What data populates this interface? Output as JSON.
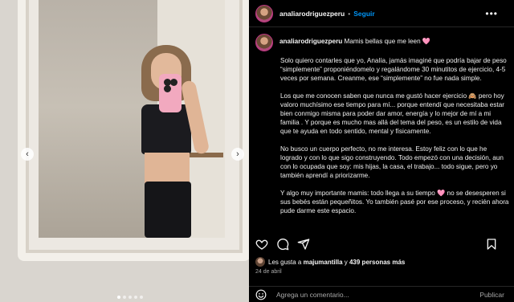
{
  "header": {
    "username": "analiarodriguezperu",
    "separator": "•",
    "follow_label": "Seguir",
    "more_icon": "more-horizontal-icon"
  },
  "caption": {
    "username": "analiarodriguezperu",
    "title": "Mamis bellas que me leen 🩷",
    "paragraphs": [
      "Solo quiero contarles que yo, Analía, jamás imaginé que podría bajar de peso “simplemente” proponiéndomelo y regalándome 30 minutitos de ejercicio, 4-5 veces por semana. Creanme, ese “simplemente” no fue nada simple.",
      "Los que me conocen saben que nunca me gustó hacer ejercicio 🙈 pero hoy valoro muchísimo ese tiempo para mí... porque entendí que necesitaba estar bien conmigo misma para poder dar amor, energía y lo mejor de mí a mi familia . Y porque es mucho mas allá del tema del peso, es un estilo de vida que te ayuda en todo sentido, mental y físicamente.",
      "No busco un cuerpo perfecto, no me interesa. Estoy feliz con lo que he logrado y con lo que sigo construyendo. Todo empezó con una decisión, aun con lo ocupada que soy: mis hijas, la casa, el trabajo... todo sigue, pero yo también aprendí a priorizarme.",
      "Y algo muy importante mamis: todo llega a su tiempo 🩷 no se desesperen si sus bebés están pequeñitos. Yo también pasé por ese proceso, y recién ahora pude darme este espacio."
    ]
  },
  "actions": {
    "like_icon": "heart-icon",
    "comment_icon": "comment-icon",
    "share_icon": "share-icon",
    "save_icon": "bookmark-icon"
  },
  "likes": {
    "prefix": "Les gusta a",
    "first_user": "majumantilla",
    "connector": "y",
    "others": "439 personas más"
  },
  "date": "24 de abril",
  "comment": {
    "placeholder": "Agrega un comentario...",
    "publish_label": "Publicar",
    "emoji_icon": "emoji-icon"
  },
  "media": {
    "prev_icon": "chevron-left-icon",
    "next_icon": "chevron-right-icon",
    "dots_total": 5,
    "dots_active": 0
  }
}
